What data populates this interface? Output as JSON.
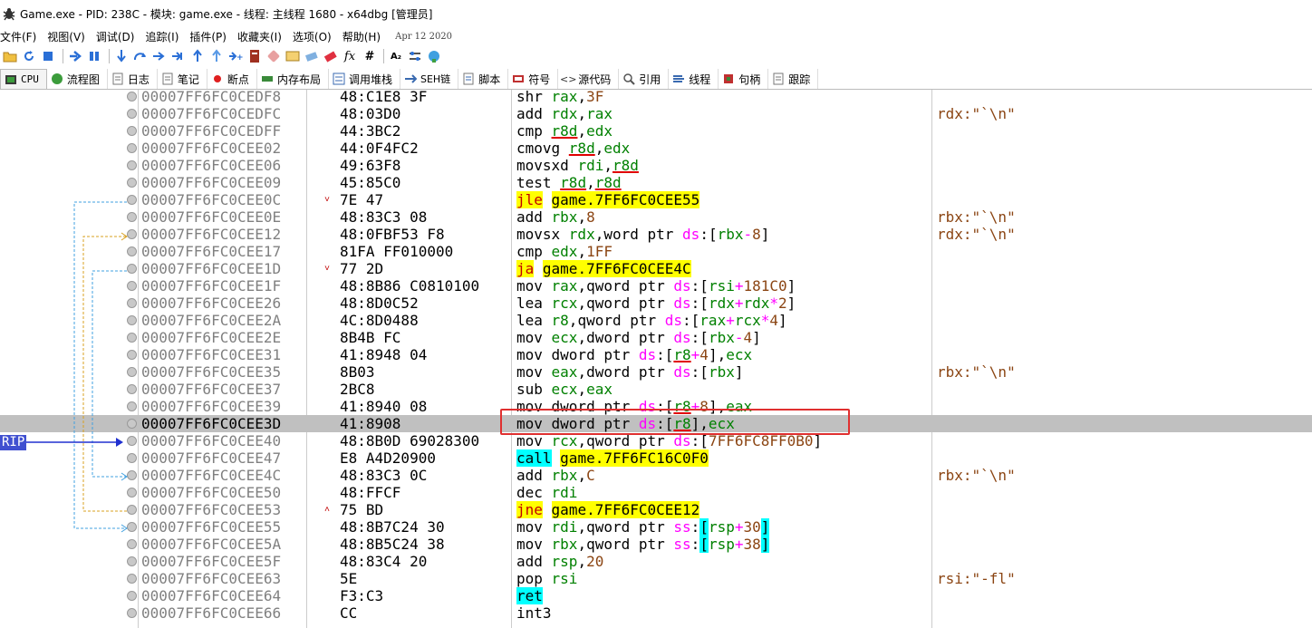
{
  "window": {
    "title": "Game.exe - PID: 238C - 模块: game.exe - 线程: 主线程 1680 - x64dbg [管理员]"
  },
  "menu": {
    "items": [
      "文件(F)",
      "视图(V)",
      "调试(D)",
      "追踪(I)",
      "插件(P)",
      "收藏夹(I)",
      "选项(O)",
      "帮助(H)"
    ],
    "date": "Apr 12 2020"
  },
  "toolbar": {
    "icons": [
      "open-folder-icon",
      "restart-icon",
      "stop-icon",
      "run-icon",
      "pause-icon",
      "step-into-icon",
      "step-over-icon",
      "trace-into-icon",
      "trace-over-icon",
      "execute-till-return-icon",
      "run-to-user-code-icon",
      "scylla-icon",
      "patch-icon",
      "comment-icon",
      "label-icon",
      "bookmark-icon",
      "function-icon",
      "hash-icon",
      "font-icon",
      "preferences-icon",
      "calculator-icon"
    ],
    "fx": "fx",
    "hash": "#",
    "az": "A₂"
  },
  "tabs": [
    {
      "label": "CPU",
      "icon": "cpu-icon"
    },
    {
      "label": "流程图",
      "icon": "graph-icon"
    },
    {
      "label": "日志",
      "icon": "log-icon"
    },
    {
      "label": "笔记",
      "icon": "notes-icon"
    },
    {
      "label": "断点",
      "icon": "breakpoint-icon"
    },
    {
      "label": "内存布局",
      "icon": "memory-map-icon"
    },
    {
      "label": "调用堆栈",
      "icon": "call-stack-icon"
    },
    {
      "label": "SEH链",
      "icon": "seh-icon"
    },
    {
      "label": "脚本",
      "icon": "script-icon"
    },
    {
      "label": "符号",
      "icon": "symbols-icon"
    },
    {
      "label": "源代码",
      "icon": "source-icon"
    },
    {
      "label": "引用",
      "icon": "references-icon"
    },
    {
      "label": "线程",
      "icon": "threads-icon"
    },
    {
      "label": "句柄",
      "icon": "handles-icon"
    },
    {
      "label": "跟踪",
      "icon": "trace-icon"
    }
  ],
  "rip_label": "RIP",
  "rows": [
    {
      "addr": "00007FF6FC0CEDF8",
      "bytes": "48:C1E8 3F",
      "mark": "",
      "comment": ""
    },
    {
      "addr": "00007FF6FC0CEDFC",
      "bytes": "48:03D0",
      "mark": "",
      "comment": "rdx:\"`\\n\""
    },
    {
      "addr": "00007FF6FC0CEDFF",
      "bytes": "44:3BC2",
      "mark": "",
      "comment": ""
    },
    {
      "addr": "00007FF6FC0CEE02",
      "bytes": "44:0F4FC2",
      "mark": "",
      "comment": ""
    },
    {
      "addr": "00007FF6FC0CEE06",
      "bytes": "49:63F8",
      "mark": "",
      "comment": ""
    },
    {
      "addr": "00007FF6FC0CEE09",
      "bytes": "45:85C0",
      "mark": "",
      "comment": ""
    },
    {
      "addr": "00007FF6FC0CEE0C",
      "bytes": "7E 47",
      "mark": "˅",
      "comment": ""
    },
    {
      "addr": "00007FF6FC0CEE0E",
      "bytes": "48:83C3 08",
      "mark": "",
      "comment": "rbx:\"`\\n\""
    },
    {
      "addr": "00007FF6FC0CEE12",
      "bytes": "48:0FBF53 F8",
      "mark": "",
      "comment": "rdx:\"`\\n\""
    },
    {
      "addr": "00007FF6FC0CEE17",
      "bytes": "81FA FF010000",
      "mark": "",
      "comment": ""
    },
    {
      "addr": "00007FF6FC0CEE1D",
      "bytes": "77 2D",
      "mark": "˅",
      "comment": ""
    },
    {
      "addr": "00007FF6FC0CEE1F",
      "bytes": "48:8B86 C0810100",
      "mark": "",
      "comment": ""
    },
    {
      "addr": "00007FF6FC0CEE26",
      "bytes": "48:8D0C52",
      "mark": "",
      "comment": ""
    },
    {
      "addr": "00007FF6FC0CEE2A",
      "bytes": "4C:8D0488",
      "mark": "",
      "comment": ""
    },
    {
      "addr": "00007FF6FC0CEE2E",
      "bytes": "8B4B FC",
      "mark": "",
      "comment": ""
    },
    {
      "addr": "00007FF6FC0CEE31",
      "bytes": "41:8948 04",
      "mark": "",
      "comment": ""
    },
    {
      "addr": "00007FF6FC0CEE35",
      "bytes": "8B03",
      "mark": "",
      "comment": "rbx:\"`\\n\""
    },
    {
      "addr": "00007FF6FC0CEE37",
      "bytes": "2BC8",
      "mark": "",
      "comment": ""
    },
    {
      "addr": "00007FF6FC0CEE39",
      "bytes": "41:8940 08",
      "mark": "",
      "comment": ""
    },
    {
      "addr": "00007FF6FC0CEE3D",
      "bytes": "41:8908",
      "mark": "",
      "comment": ""
    },
    {
      "addr": "00007FF6FC0CEE40",
      "bytes": "48:8B0D 69028300",
      "mark": "",
      "comment": ""
    },
    {
      "addr": "00007FF6FC0CEE47",
      "bytes": "E8 A4D20900",
      "mark": "",
      "comment": ""
    },
    {
      "addr": "00007FF6FC0CEE4C",
      "bytes": "48:83C3 0C",
      "mark": "",
      "comment": "rbx:\"`\\n\""
    },
    {
      "addr": "00007FF6FC0CEE50",
      "bytes": "48:FFCF",
      "mark": "",
      "comment": ""
    },
    {
      "addr": "00007FF6FC0CEE53",
      "bytes": "75 BD",
      "mark": "˄",
      "comment": ""
    },
    {
      "addr": "00007FF6FC0CEE55",
      "bytes": "48:8B7C24 30",
      "mark": "",
      "comment": ""
    },
    {
      "addr": "00007FF6FC0CEE5A",
      "bytes": "48:8B5C24 38",
      "mark": "",
      "comment": ""
    },
    {
      "addr": "00007FF6FC0CEE5F",
      "bytes": "48:83C4 20",
      "mark": "",
      "comment": ""
    },
    {
      "addr": "00007FF6FC0CEE63",
      "bytes": "5E",
      "mark": "",
      "comment": "rsi:\"-fl\""
    },
    {
      "addr": "00007FF6FC0CEE64",
      "bytes": "F3:C3",
      "mark": "",
      "comment": ""
    },
    {
      "addr": "00007FF6FC0CEE66",
      "bytes": "CC",
      "mark": "",
      "comment": ""
    }
  ],
  "disasm": {
    "r0": [
      "shr ",
      "rax",
      ",",
      "3F"
    ],
    "r1": [
      "add ",
      "rdx",
      ",",
      "rax"
    ],
    "r2": [
      "cmp ",
      "r8d",
      ",",
      "edx"
    ],
    "r3": [
      "cmovg ",
      "r8d",
      ",",
      "edx"
    ],
    "r4": [
      "movsxd ",
      "rdi",
      ",",
      "r8d"
    ],
    "r5": [
      "test ",
      "r8d",
      ",",
      "r8d"
    ],
    "r6": [
      "jle",
      " ",
      "game.7FF6FC0CEE55"
    ],
    "r7": [
      "add ",
      "rbx",
      ",",
      "8"
    ],
    "r8": [
      "movsx ",
      "rdx",
      ",",
      "word ptr ",
      "ds",
      ":[",
      "rbx",
      "-",
      "8",
      "]"
    ],
    "r9": [
      "cmp ",
      "edx",
      ",",
      "1FF"
    ],
    "r10": [
      "ja",
      " ",
      "game.7FF6FC0CEE4C"
    ],
    "r11": [
      "mov ",
      "rax",
      ",",
      "qword ptr ",
      "ds",
      ":[",
      "rsi",
      "+",
      "181C0",
      "]"
    ],
    "r12": [
      "lea ",
      "rcx",
      ",",
      "qword ptr ",
      "ds",
      ":[",
      "rdx",
      "+",
      "rdx",
      "*",
      "2",
      "]"
    ],
    "r13": [
      "lea ",
      "r8",
      ",",
      "qword ptr ",
      "ds",
      ":[",
      "rax",
      "+",
      "rcx",
      "*",
      "4",
      "]"
    ],
    "r14": [
      "mov ",
      "ecx",
      ",",
      "dword ptr ",
      "ds",
      ":[",
      "rbx",
      "-",
      "4",
      "]"
    ],
    "r15": [
      "mov ",
      "dword ptr ",
      "ds",
      ":[",
      "r8",
      "+",
      "4",
      "],",
      "ecx"
    ],
    "r16": [
      "mov ",
      "eax",
      ",",
      "dword ptr ",
      "ds",
      ":[",
      "rbx",
      "]"
    ],
    "r17": [
      "sub ",
      "ecx",
      ",",
      "eax"
    ],
    "r18": [
      "mov ",
      "dword ptr ",
      "ds",
      ":[",
      "r8",
      "+",
      "8",
      "],",
      "eax"
    ],
    "r19": [
      "mov ",
      "dword ptr ",
      "ds",
      ":[",
      "r8",
      "],",
      "ecx"
    ],
    "r20": [
      "mov ",
      "rcx",
      ",",
      "qword ptr ",
      "ds",
      ":[",
      "7FF6FC8FF0B0",
      "]"
    ],
    "r21": [
      "call",
      " ",
      "game.7FF6FC16C0F0"
    ],
    "r22": [
      "add ",
      "rbx",
      ",",
      "C"
    ],
    "r23": [
      "dec ",
      "rdi"
    ],
    "r24": [
      "jne",
      " ",
      "game.7FF6FC0CEE12"
    ],
    "r25": [
      "mov ",
      "rdi",
      ",",
      "qword ptr ",
      "ss",
      ":",
      "[",
      "rsp",
      "+",
      "30",
      "]"
    ],
    "r26": [
      "mov ",
      "rbx",
      ",",
      "qword ptr ",
      "ss",
      ":",
      "[",
      "rsp",
      "+",
      "38",
      "]"
    ],
    "r27": [
      "add ",
      "rsp",
      ",",
      "20"
    ],
    "r28": [
      "pop ",
      "rsi"
    ],
    "r29": [
      "ret"
    ],
    "r30": [
      "int3"
    ]
  },
  "colors": {
    "highlight_box": "#e03030",
    "rip_badge": "#4050d0",
    "current_row": "#c0c0c0"
  }
}
